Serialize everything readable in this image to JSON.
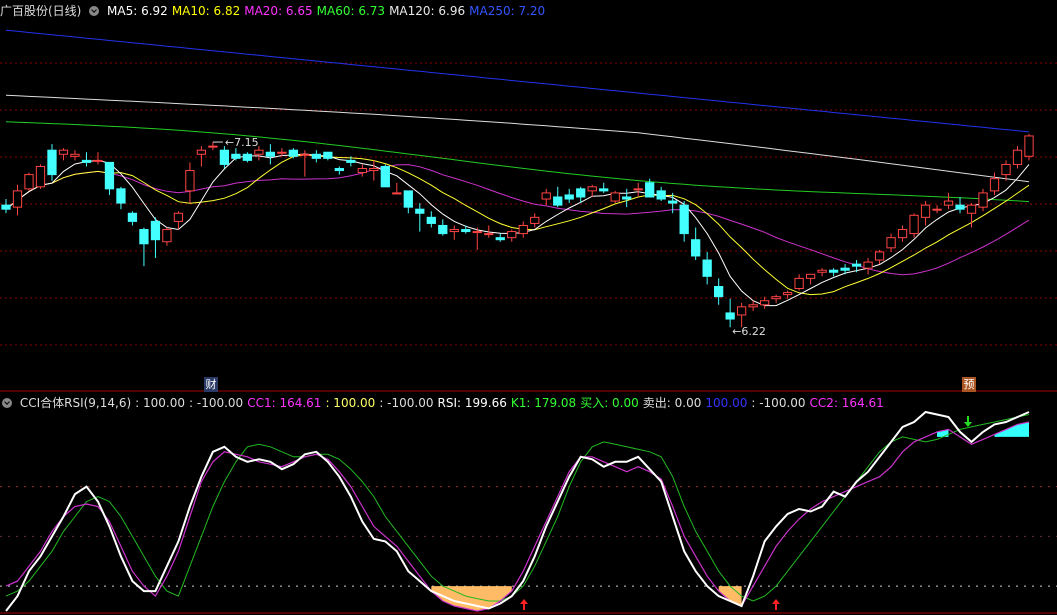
{
  "main": {
    "stock_name": "广百股份(日线)",
    "ma_legend": [
      {
        "label": "MA5: 6.92",
        "color": "#ffffff"
      },
      {
        "label": "MA10: 6.82",
        "color": "#ffff00"
      },
      {
        "label": "MA20: 6.65",
        "color": "#ff33ff"
      },
      {
        "label": "MA60: 6.73",
        "color": "#33ff33"
      },
      {
        "label": "MA120: 6.96",
        "color": "#e8e8e8"
      },
      {
        "label": "MA250: 7.20",
        "color": "#3355ff"
      }
    ],
    "high_label": "7.15",
    "low_label": "6.22",
    "badge_left": "财",
    "badge_right": "预"
  },
  "indicator": {
    "legend": [
      {
        "label": "CCI合体RSI(9,14,6)",
        "color": "#dddddd"
      },
      {
        "label": ": 100.00",
        "color": "#dddddd"
      },
      {
        "label": ": -100.00",
        "color": "#dddddd"
      },
      {
        "label": "CC1: 164.61",
        "color": "#ff33ff"
      },
      {
        "label": ": 100.00",
        "color": "#ffff66"
      },
      {
        "label": ": -100.00",
        "color": "#dddddd"
      },
      {
        "label": "RSI: 199.66",
        "color": "#ffffff"
      },
      {
        "label": "K1: 179.08",
        "color": "#33ff33"
      },
      {
        "label": "买入: 0.00",
        "color": "#33ff33"
      },
      {
        "label": "卖出: 0.00",
        "color": "#dddddd"
      },
      {
        "label": "100.00",
        "color": "#3333ff"
      },
      {
        "label": ": -100.00",
        "color": "#dddddd"
      },
      {
        "label": "CC2: 164.61",
        "color": "#ff33ff"
      }
    ]
  },
  "colors": {
    "up": "#ff4444",
    "down": "#44ffff",
    "grid": "#8b0000",
    "ma5": "#ffffff",
    "ma10": "#ffff33",
    "ma20": "#cc33cc",
    "ma60": "#22cc22",
    "ma120": "#dddddd",
    "ma250": "#2233ee",
    "orange_fill": "#ffbb66",
    "cyan_fill": "#33ffff",
    "rsi_line": "#ffffff",
    "cc_line": "#cc33cc",
    "k1_line": "#22bb22",
    "buy_arrow": "#ff2222",
    "sell_arrow": "#22dd22"
  },
  "chart_data": [
    {
      "type": "candlestick",
      "title": "广百股份(日线)",
      "ylim": [
        6.0,
        7.75
      ],
      "candles": [
        [
          6.84,
          6.87,
          6.8,
          6.82
        ],
        [
          6.83,
          6.94,
          6.79,
          6.91
        ],
        [
          6.92,
          7.0,
          6.91,
          6.99
        ],
        [
          6.93,
          7.04,
          6.92,
          7.03
        ],
        [
          7.11,
          7.14,
          6.96,
          6.99
        ],
        [
          7.09,
          7.12,
          7.06,
          7.11
        ],
        [
          7.08,
          7.11,
          7.06,
          7.09
        ],
        [
          7.06,
          7.1,
          7.03,
          7.05
        ],
        [
          7.06,
          7.1,
          7.04,
          7.06
        ],
        [
          7.05,
          7.05,
          6.89,
          6.92
        ],
        [
          6.92,
          6.93,
          6.82,
          6.85
        ],
        [
          6.8,
          6.81,
          6.74,
          6.76
        ],
        [
          6.72,
          6.73,
          6.54,
          6.65
        ],
        [
          6.76,
          6.78,
          6.58,
          6.67
        ],
        [
          6.66,
          6.73,
          6.64,
          6.72
        ],
        [
          6.76,
          6.81,
          6.72,
          6.8
        ],
        [
          6.91,
          7.05,
          6.85,
          7.01
        ],
        [
          7.09,
          7.13,
          7.03,
          7.11
        ],
        [
          7.13,
          7.15,
          7.11,
          7.13
        ],
        [
          7.11,
          7.13,
          7.02,
          7.04
        ],
        [
          7.09,
          7.12,
          7.06,
          7.07
        ],
        [
          7.09,
          7.1,
          7.05,
          7.06
        ],
        [
          7.09,
          7.13,
          7.06,
          7.11
        ],
        [
          7.1,
          7.14,
          7.04,
          7.08
        ],
        [
          7.1,
          7.12,
          7.08,
          7.1
        ],
        [
          7.11,
          7.12,
          7.07,
          7.08
        ],
        [
          7.09,
          7.11,
          6.98,
          7.09
        ],
        [
          7.09,
          7.11,
          7.05,
          7.07
        ],
        [
          7.1,
          7.1,
          7.06,
          7.07
        ],
        [
          7.02,
          7.03,
          6.99,
          7.01
        ],
        [
          7.06,
          7.08,
          7.03,
          7.05
        ],
        [
          7.0,
          7.04,
          6.98,
          7.02
        ],
        [
          7.01,
          7.06,
          6.96,
          7.02
        ],
        [
          7.03,
          7.04,
          6.97,
          6.93
        ],
        [
          6.9,
          6.95,
          6.9,
          6.9
        ],
        [
          6.91,
          6.91,
          6.8,
          6.83
        ],
        [
          6.82,
          6.85,
          6.71,
          6.8
        ],
        [
          6.78,
          6.81,
          6.73,
          6.75
        ],
        [
          6.74,
          6.77,
          6.69,
          6.7
        ],
        [
          6.71,
          6.74,
          6.67,
          6.72
        ],
        [
          6.72,
          6.74,
          6.7,
          6.71
        ],
        [
          6.71,
          6.73,
          6.62,
          6.71
        ],
        [
          6.7,
          6.74,
          6.68,
          6.7
        ],
        [
          6.68,
          6.7,
          6.66,
          6.67
        ],
        [
          6.68,
          6.72,
          6.66,
          6.71
        ],
        [
          6.7,
          6.76,
          6.68,
          6.74
        ],
        [
          6.75,
          6.8,
          6.73,
          6.78
        ],
        [
          6.87,
          6.92,
          6.84,
          6.9
        ],
        [
          6.88,
          6.93,
          6.83,
          6.84
        ],
        [
          6.89,
          6.92,
          6.85,
          6.87
        ],
        [
          6.92,
          6.93,
          6.85,
          6.88
        ],
        [
          6.91,
          6.94,
          6.88,
          6.93
        ],
        [
          6.92,
          6.95,
          6.9,
          6.91
        ],
        [
          6.86,
          6.91,
          6.85,
          6.9
        ],
        [
          6.88,
          6.92,
          6.83,
          6.87
        ],
        [
          6.92,
          6.95,
          6.88,
          6.92
        ],
        [
          6.95,
          6.97,
          6.9,
          6.88
        ],
        [
          6.91,
          6.93,
          6.86,
          6.87
        ],
        [
          6.86,
          6.9,
          6.8,
          6.85
        ],
        [
          6.84,
          6.86,
          6.66,
          6.7
        ],
        [
          6.67,
          6.73,
          6.57,
          6.59
        ],
        [
          6.57,
          6.61,
          6.45,
          6.49
        ],
        [
          6.44,
          6.48,
          6.35,
          6.39
        ],
        [
          6.31,
          6.38,
          6.24,
          6.28
        ],
        [
          6.3,
          6.36,
          6.24,
          6.34
        ],
        [
          6.34,
          6.37,
          6.32,
          6.35
        ],
        [
          6.35,
          6.39,
          6.33,
          6.37
        ],
        [
          6.38,
          6.4,
          6.36,
          6.39
        ],
        [
          6.4,
          6.42,
          6.38,
          6.41
        ],
        [
          6.43,
          6.5,
          6.42,
          6.48
        ],
        [
          6.48,
          6.5,
          6.45,
          6.5
        ],
        [
          6.51,
          6.53,
          6.49,
          6.52
        ],
        [
          6.52,
          6.53,
          6.49,
          6.51
        ],
        [
          6.53,
          6.55,
          6.5,
          6.52
        ],
        [
          6.55,
          6.57,
          6.51,
          6.54
        ],
        [
          6.53,
          6.58,
          6.5,
          6.56
        ],
        [
          6.57,
          6.62,
          6.55,
          6.61
        ],
        [
          6.63,
          6.7,
          6.61,
          6.68
        ],
        [
          6.68,
          6.74,
          6.66,
          6.72
        ],
        [
          6.7,
          6.8,
          6.68,
          6.79
        ],
        [
          6.78,
          6.86,
          6.74,
          6.84
        ],
        [
          6.82,
          6.84,
          6.8,
          6.82
        ],
        [
          6.84,
          6.9,
          6.82,
          6.86
        ],
        [
          6.84,
          6.88,
          6.8,
          6.82
        ],
        [
          6.8,
          6.85,
          6.73,
          6.84
        ],
        [
          6.83,
          6.92,
          6.81,
          6.9
        ],
        [
          6.91,
          7.0,
          6.89,
          6.97
        ],
        [
          6.99,
          7.06,
          6.96,
          7.04
        ],
        [
          7.04,
          7.13,
          7.02,
          7.11
        ],
        [
          7.08,
          7.19,
          7.06,
          7.18
        ]
      ]
    },
    {
      "type": "line",
      "title": "CCI合体RSI(9,14,6)",
      "ylim": [
        -150,
        250
      ],
      "series": [
        {
          "name": "RSI",
          "values": [
            -150,
            -120,
            -70,
            -40,
            0,
            40,
            85,
            100,
            70,
            20,
            -40,
            -90,
            -110,
            -110,
            -60,
            -10,
            60,
            120,
            170,
            180,
            160,
            150,
            155,
            150,
            135,
            145,
            165,
            170,
            150,
            120,
            80,
            30,
            -5,
            -10,
            -30,
            -70,
            -90,
            -110,
            -120,
            -130,
            -135,
            -140,
            -145,
            -135,
            -120,
            -90,
            -40,
            20,
            70,
            120,
            160,
            155,
            140,
            150,
            150,
            160,
            135,
            110,
            40,
            -30,
            -70,
            -100,
            -120,
            -130,
            -140,
            -80,
            -10,
            20,
            45,
            55,
            50,
            60,
            90,
            80,
            110,
            130,
            160,
            190,
            220,
            230,
            250,
            245,
            240,
            210,
            190,
            210,
            225,
            230,
            240,
            250
          ]
        },
        {
          "name": "CC2",
          "values": [
            -100,
            -90,
            -60,
            -30,
            10,
            40,
            60,
            65,
            60,
            30,
            -20,
            -70,
            -100,
            -120,
            -80,
            -30,
            40,
            110,
            150,
            170,
            165,
            160,
            150,
            145,
            140,
            150,
            160,
            165,
            155,
            130,
            100,
            60,
            20,
            0,
            -20,
            -50,
            -80,
            -110,
            -130,
            -140,
            -145,
            -150,
            -145,
            -130,
            -110,
            -70,
            -20,
            30,
            80,
            130,
            160,
            160,
            150,
            140,
            130,
            140,
            130,
            115,
            60,
            0,
            -40,
            -80,
            -110,
            -130,
            -140,
            -100,
            -60,
            -20,
            10,
            35,
            55,
            70,
            80,
            90,
            100,
            110,
            120,
            140,
            170,
            190,
            200,
            210,
            215,
            200,
            185,
            195,
            205,
            215,
            225,
            230
          ]
        },
        {
          "name": "K1",
          "values": [
            -120,
            -110,
            -90,
            -60,
            -30,
            10,
            40,
            70,
            80,
            70,
            40,
            0,
            -40,
            -80,
            -110,
            -120,
            -60,
            0,
            60,
            110,
            150,
            180,
            185,
            180,
            170,
            160,
            160,
            165,
            165,
            155,
            135,
            110,
            80,
            40,
            10,
            -20,
            -50,
            -80,
            -100,
            -110,
            -120,
            -125,
            -130,
            -130,
            -120,
            -100,
            -60,
            -10,
            40,
            100,
            150,
            180,
            190,
            185,
            180,
            175,
            170,
            160,
            120,
            60,
            10,
            -30,
            -70,
            -100,
            -120,
            -130,
            -120,
            -100,
            -70,
            -40,
            -10,
            20,
            50,
            80,
            110,
            140,
            170,
            190,
            200,
            195,
            190,
            195,
            205,
            215,
            220,
            225,
            230,
            235,
            240,
            245
          ]
        }
      ]
    }
  ]
}
